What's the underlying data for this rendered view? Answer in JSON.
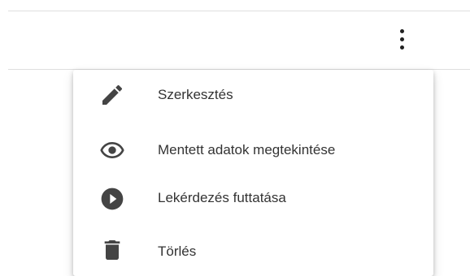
{
  "header": {
    "more_actions_icon": "more-vert-icon"
  },
  "menu": {
    "items": [
      {
        "label": "Szerkesztés",
        "icon": "pencil-icon"
      },
      {
        "label": "Mentett adatok megtekintése",
        "icon": "eye-icon"
      },
      {
        "label": "Lekérdezés futtatása",
        "icon": "play-circle-icon"
      },
      {
        "label": "Törlés",
        "icon": "trash-icon"
      }
    ]
  },
  "colors": {
    "icon": "#444444",
    "text": "#333333",
    "divider": "#dedede"
  }
}
